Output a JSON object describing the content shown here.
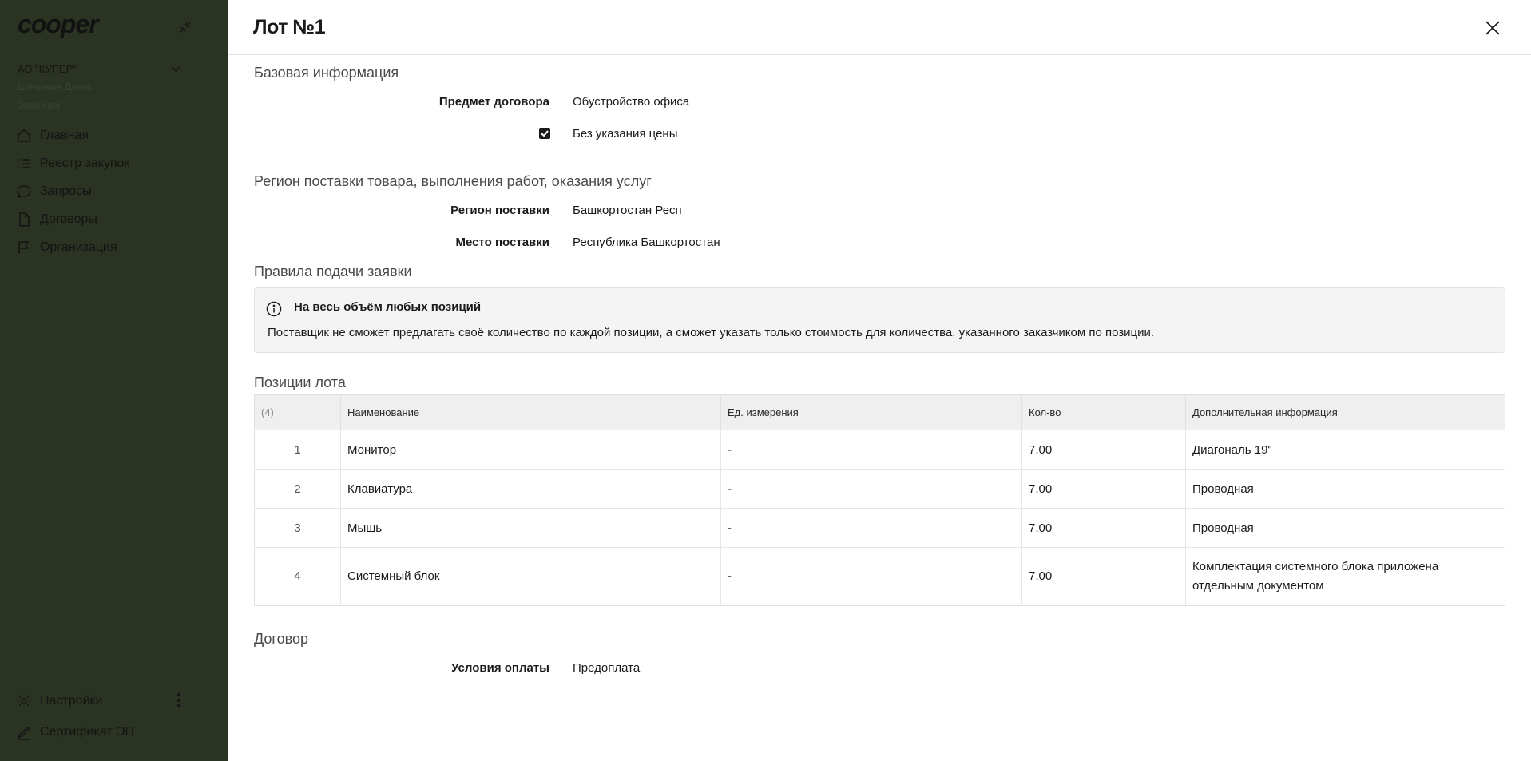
{
  "sidebar": {
    "logo": "cooper",
    "org": "АО \"КУПЕР\"",
    "user": "Шемякин Денис",
    "role": "Заказчик",
    "nav": [
      {
        "label": "Главная",
        "icon": "home-icon"
      },
      {
        "label": "Реестр закупок",
        "icon": "list-icon"
      },
      {
        "label": "Запросы",
        "icon": "chat-icon"
      },
      {
        "label": "Договоры",
        "icon": "document-icon"
      },
      {
        "label": "Организация",
        "icon": "flag-icon"
      }
    ],
    "bottom": [
      {
        "label": "Настройки",
        "icon": "gear-icon"
      },
      {
        "label": "Сертификат ЭП",
        "icon": "signature-icon"
      }
    ]
  },
  "panel": {
    "title": "Лот №1",
    "base_info": {
      "section_title": "Базовая информация",
      "subject_label": "Предмет договора",
      "subject_value": "Обустройство офиса",
      "no_price_label": "Без указания цены",
      "no_price_checked": true
    },
    "region": {
      "section_title": "Регион поставки товара, выполнения работ, оказания услуг",
      "region_label": "Регион поставки",
      "region_value": "Башкортостан Респ",
      "place_label": "Место поставки",
      "place_value": "Республика Башкортостан"
    },
    "rules": {
      "section_title": "Правила подачи заявки",
      "info_title": "На весь объём любых позиций",
      "info_text": "Поставщик не сможет предлагать своё количество по каждой позиции, а сможет указать только стоимость для количества, указанного заказчиком по позиции."
    },
    "positions": {
      "section_title": "Позиции лота",
      "count": "(4)",
      "headers": [
        "Наименование",
        "Ед. измерения",
        "Кол-во",
        "Дополнительная информация"
      ],
      "rows": [
        {
          "num": "1",
          "name": "Монитор",
          "unit": "-",
          "qty": "7.00",
          "info": "Диагональ 19\""
        },
        {
          "num": "2",
          "name": "Клавиатура",
          "unit": "-",
          "qty": "7.00",
          "info": "Проводная"
        },
        {
          "num": "3",
          "name": "Мышь",
          "unit": "-",
          "qty": "7.00",
          "info": "Проводная"
        },
        {
          "num": "4",
          "name": "Системный блок",
          "unit": "-",
          "qty": "7.00",
          "info": "Комплектация системного блока приложена отдельным документом"
        }
      ]
    },
    "contract": {
      "section_title": "Договор",
      "payment_label": "Условия оплаты",
      "payment_value": "Предоплата"
    }
  }
}
